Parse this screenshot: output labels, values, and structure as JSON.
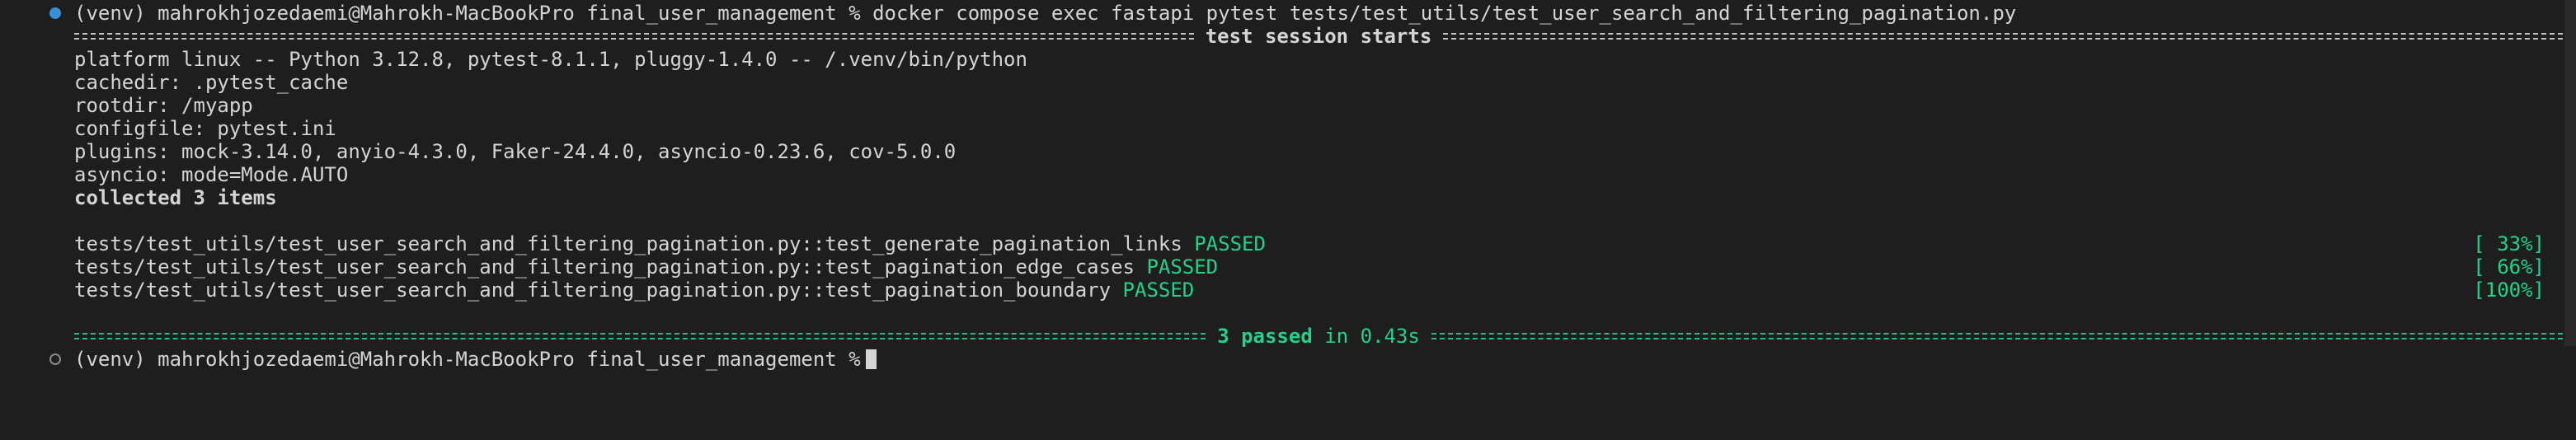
{
  "terminal": {
    "prompt_1": "(venv) mahrokhjozedaemi@Mahrokh-MacBookPro final_user_management % docker compose exec fastapi pytest tests/test_utils/test_user_search_and_filtering_pagination.py",
    "session_start_label": "test session starts",
    "platform": "platform linux -- Python 3.12.8, pytest-8.1.1, pluggy-1.4.0 -- /.venv/bin/python",
    "cachedir": "cachedir: .pytest_cache",
    "rootdir": "rootdir: /myapp",
    "configfile": "configfile: pytest.ini",
    "plugins": "plugins: mock-3.14.0, anyio-4.3.0, Faker-24.4.0, asyncio-0.23.6, cov-5.0.0",
    "asyncio": "asyncio: mode=Mode.AUTO",
    "collected": "collected 3 items",
    "tests": [
      {
        "path": "tests/test_utils/test_user_search_and_filtering_pagination.py::test_generate_pagination_links",
        "status": "PASSED",
        "percent": "[ 33%]"
      },
      {
        "path": "tests/test_utils/test_user_search_and_filtering_pagination.py::test_pagination_edge_cases",
        "status": "PASSED",
        "percent": "[ 66%]"
      },
      {
        "path": "tests/test_utils/test_user_search_and_filtering_pagination.py::test_pagination_boundary",
        "status": "PASSED",
        "percent": "[100%]"
      }
    ],
    "summary_passed": "3 passed",
    "summary_time": "in 0.43s",
    "prompt_2": "(venv) mahrokhjozedaemi@Mahrokh-MacBookPro final_user_management %"
  },
  "colors": {
    "background": "#1e1e1e",
    "text": "#d4d4d4",
    "success": "#23d18b",
    "prompt_dot": "#3b8fd9"
  }
}
